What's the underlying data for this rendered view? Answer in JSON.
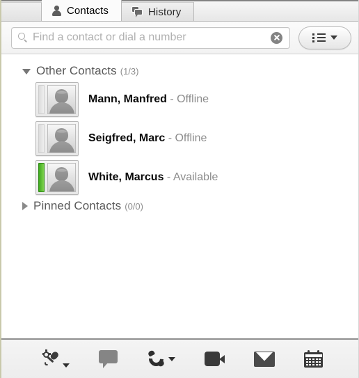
{
  "tabs": {
    "stub": {
      "name": "tab-stub"
    },
    "items": [
      {
        "label": "Contacts",
        "icon": "person-icon",
        "active": true
      },
      {
        "label": "History",
        "icon": "history-icon",
        "active": false
      }
    ]
  },
  "search": {
    "placeholder": "Find a contact or dial a number",
    "value": "",
    "search_icon": "search-icon",
    "clear_icon": "clear-icon",
    "view_button": {
      "list_icon": "list-view-icon",
      "caret": "chevron-down-icon"
    }
  },
  "groups": [
    {
      "title": "Other Contacts",
      "count": "(1/3)",
      "expanded": true,
      "contacts": [
        {
          "name": "Mann, Manfred",
          "separator": " - ",
          "status": "Offline",
          "presence": "offline"
        },
        {
          "name": "Seigfred, Marc",
          "separator": " - ",
          "status": "Offline",
          "presence": "offline"
        },
        {
          "name": "White, Marcus",
          "separator": " - ",
          "status": "Available",
          "presence": "available"
        }
      ]
    },
    {
      "title": "Pinned Contacts",
      "count": "(0/0)",
      "expanded": false,
      "contacts": []
    }
  ],
  "toolbar": {
    "buttons": [
      {
        "name": "audio-settings-button",
        "icon": "microphone-settings-icon",
        "has_caret": true
      },
      {
        "name": "chat-button",
        "icon": "chat-bubble-icon",
        "has_caret": false
      },
      {
        "name": "call-button",
        "icon": "phone-icon",
        "has_caret": true
      },
      {
        "name": "video-call-button",
        "icon": "video-camera-icon",
        "has_caret": false
      },
      {
        "name": "email-button",
        "icon": "envelope-icon",
        "has_caret": false
      },
      {
        "name": "schedule-meeting-button",
        "icon": "calendar-icon",
        "has_caret": false
      }
    ]
  },
  "colors": {
    "available": "#5cba2e",
    "offline": "#dcdcdc",
    "name_text": "#0a0a0a",
    "status_text": "#8c8c8c",
    "group_text": "#595959"
  }
}
